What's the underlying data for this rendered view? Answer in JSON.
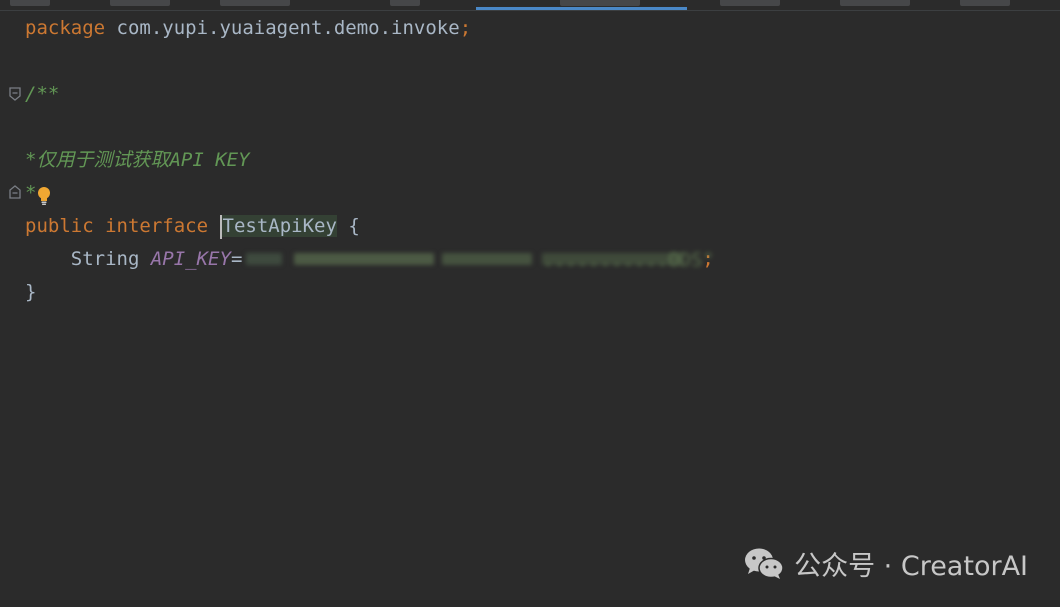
{
  "editor": {
    "lines": {
      "package_keyword": "package",
      "package_name": " com.yupi.yuaiagent.demo.invoke",
      "package_semicolon": ";",
      "doc_open": "/**",
      "doc_body": "*仅用于测试获取API KEY",
      "doc_close": "*",
      "public_keyword": "public",
      "interface_keyword": "interface",
      "class_name": "TestApiKey",
      "open_brace": " {",
      "indent": "    ",
      "field_type": "String",
      "field_name": "API_KEY",
      "field_assign": "=",
      "field_value_blurred": "...........ODS\"",
      "field_semicolon": ";",
      "close_brace": "}"
    }
  },
  "icons": {
    "fold_start": "fold-start-icon",
    "fold_end": "fold-end-icon",
    "intention": "lightbulb-icon",
    "brand": "wechat-icon"
  },
  "colors": {
    "background": "#2b2b2b",
    "keyword": "#cc7832",
    "doc_comment": "#629755",
    "constant": "#9876aa",
    "plain": "#a9b7c6",
    "active_tab": "#4a88c7",
    "bulb": "#f0a732"
  },
  "watermark": {
    "label": "公众号 · CreatorAI"
  }
}
